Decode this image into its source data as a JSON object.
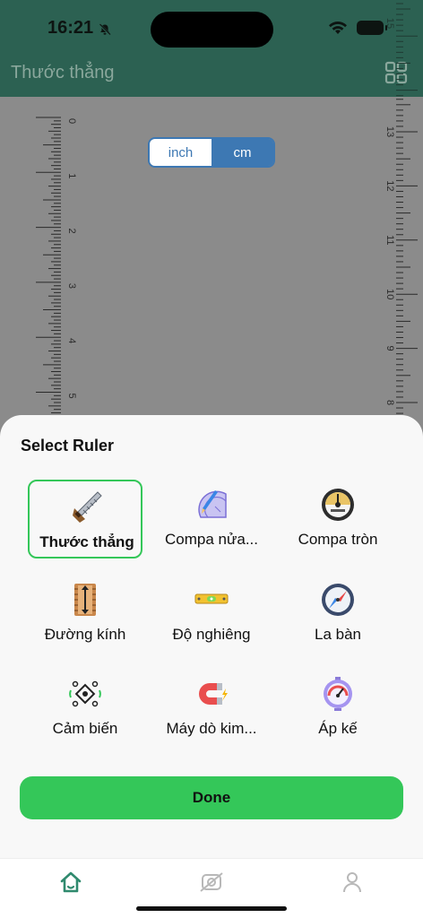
{
  "status_bar": {
    "time": "16:21"
  },
  "header": {
    "title": "Thước thẳng",
    "grid_icon": "grid-icon"
  },
  "ruler": {
    "left_labels": [
      "0",
      "1",
      "2",
      "3",
      "4",
      "5"
    ],
    "right_labels": [
      "13",
      "12",
      "11",
      "10",
      "9",
      "8"
    ],
    "right_top_label": "15",
    "unit_toggle": {
      "inch": "inch",
      "cm": "cm",
      "selected": "cm"
    }
  },
  "sheet": {
    "title": "Select Ruler",
    "items": [
      {
        "label": "Thước thẳng",
        "icon": "ruler-square-icon",
        "selected": true
      },
      {
        "label": "Compa nửa...",
        "icon": "protractor-icon",
        "selected": false
      },
      {
        "label": "Compa tròn",
        "icon": "round-compass-icon",
        "selected": false
      },
      {
        "label": "Đường kính",
        "icon": "caliper-icon",
        "selected": false
      },
      {
        "label": "Độ nghiêng",
        "icon": "spirit-level-icon",
        "selected": false
      },
      {
        "label": "La bàn",
        "icon": "compass-icon",
        "selected": false
      },
      {
        "label": "Cảm biến",
        "icon": "sensor-icon",
        "selected": false
      },
      {
        "label": "Máy dò kim...",
        "icon": "magnet-icon",
        "selected": false
      },
      {
        "label": "Áp kế",
        "icon": "pressure-gauge-icon",
        "selected": false
      }
    ],
    "done_label": "Done"
  },
  "tabbar": {
    "tabs": [
      "home-icon",
      "scan-icon",
      "profile-icon"
    ],
    "active": "home-icon"
  },
  "colors": {
    "accent": "#34c759",
    "header": "#2c6152",
    "segment": "#3d78b3"
  }
}
